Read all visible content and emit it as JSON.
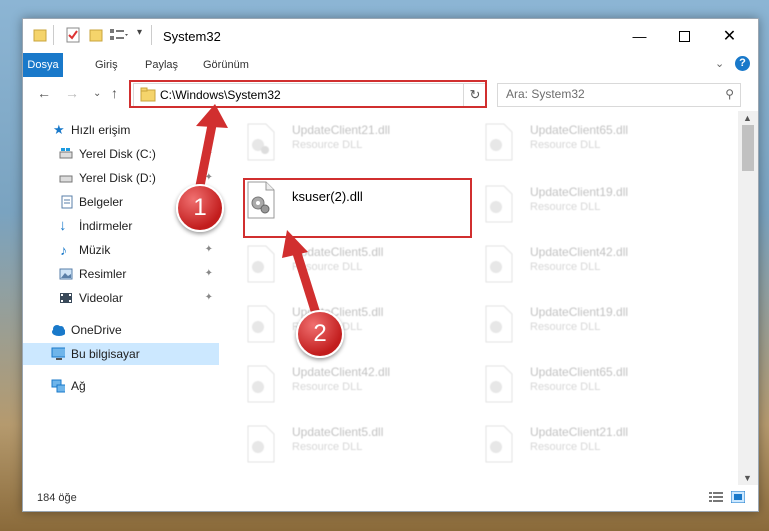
{
  "window": {
    "title": "System32"
  },
  "ribbon": {
    "tabs": [
      "Dosya",
      "Giriş",
      "Paylaş",
      "Görünüm"
    ]
  },
  "address": {
    "path": "C:\\Windows\\System32"
  },
  "search": {
    "placeholder": "Ara: System32"
  },
  "sidebar": {
    "items": [
      {
        "label": "Hızlı erişim",
        "icon": "star-icon",
        "pinned": false
      },
      {
        "label": "Yerel Disk (C:)",
        "icon": "drive-icon",
        "pinned": true
      },
      {
        "label": "Yerel Disk (D:)",
        "icon": "drive-icon",
        "pinned": true
      },
      {
        "label": "Belgeler",
        "icon": "documents-icon",
        "pinned": true
      },
      {
        "label": "İndirmeler",
        "icon": "download-icon",
        "pinned": true
      },
      {
        "label": "Müzik",
        "icon": "music-icon",
        "pinned": true
      },
      {
        "label": "Resimler",
        "icon": "pictures-icon",
        "pinned": true
      },
      {
        "label": "Videolar",
        "icon": "video-icon",
        "pinned": true
      },
      {
        "label": "OneDrive",
        "icon": "cloud-icon",
        "pinned": false
      },
      {
        "label": "Bu bilgisayar",
        "icon": "computer-icon",
        "pinned": false,
        "selected": true
      },
      {
        "label": "Ağ",
        "icon": "network-icon",
        "pinned": false
      }
    ]
  },
  "files": {
    "left": [
      {
        "name": "UpdateClient21.dll",
        "type": "Resource DLL"
      },
      {
        "name": "ksuser(2).dll",
        "type": "",
        "highlighted": true
      },
      {
        "name": "UpdateClient5.dll",
        "type": "Resource DLL"
      },
      {
        "name": "UpdateClient5.dll",
        "type": "Resource DLL"
      },
      {
        "name": "UpdateClient42.dll",
        "type": "Resource DLL"
      },
      {
        "name": "UpdateClient5.dll",
        "type": "Resource DLL"
      }
    ],
    "right": [
      {
        "name": "UpdateClient65.dll",
        "type": "Resource DLL"
      },
      {
        "name": "UpdateClient19.dll",
        "type": "Resource DLL"
      },
      {
        "name": "UpdateClient42.dll",
        "type": "Resource DLL"
      },
      {
        "name": "UpdateClient19.dll",
        "type": "Resource DLL"
      },
      {
        "name": "UpdateClient65.dll",
        "type": "Resource DLL"
      },
      {
        "name": "UpdateClient21.dll",
        "type": "Resource DLL"
      }
    ]
  },
  "status": {
    "count": "184 öğe"
  },
  "annotations": {
    "marker1": "1",
    "marker2": "2",
    "color": "#d12f2f"
  }
}
